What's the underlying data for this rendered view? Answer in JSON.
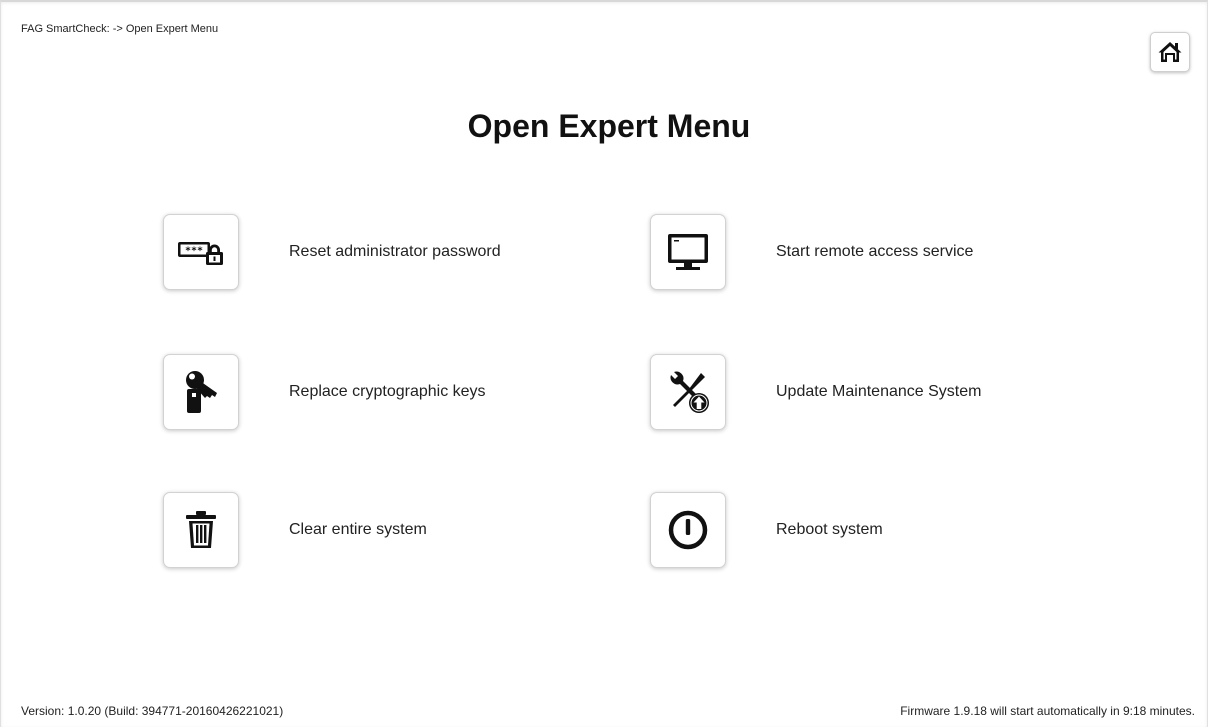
{
  "header": {
    "breadcrumb": "FAG SmartCheck: -> Open Expert Menu"
  },
  "page_title": "Open Expert Menu",
  "actions": [
    {
      "label": "Reset administrator password",
      "icon": "password-lock-icon"
    },
    {
      "label": "Start remote access service",
      "icon": "monitor-icon"
    },
    {
      "label": "Replace cryptographic keys",
      "icon": "key-icon"
    },
    {
      "label": "Update Maintenance System",
      "icon": "tools-upload-icon"
    },
    {
      "label": "Clear entire system",
      "icon": "trash-icon"
    },
    {
      "label": "Reboot system",
      "icon": "power-icon"
    }
  ],
  "footer": {
    "version": "Version: 1.0.20 (Build: 394771-20160426221021)",
    "firmware_notice": "Firmware 1.9.18 will start automatically in 9:18 minutes."
  }
}
